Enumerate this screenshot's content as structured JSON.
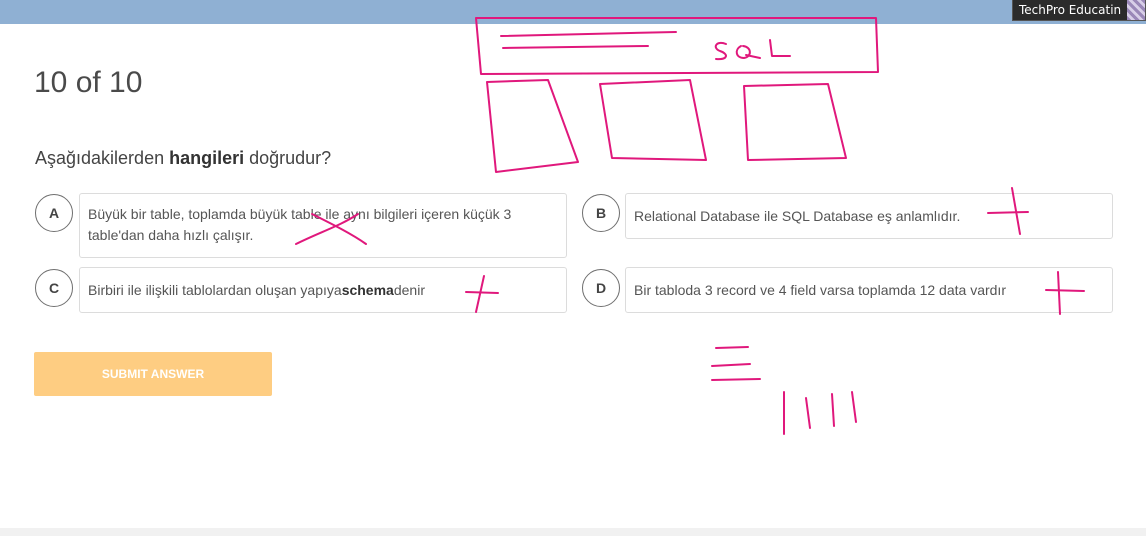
{
  "video": {
    "participant_name": "TechPro Educatin"
  },
  "quiz": {
    "progress": "10 of 10",
    "question_pre": "Aşağıdakilerden ",
    "question_bold": "hangileri",
    "question_post": " doğrudur?",
    "options": [
      {
        "letter": "A",
        "text": "Büyük bir table, toplamda büyük table ile aynı bilgileri içeren küçük 3 table'dan daha hızlı çalışır."
      },
      {
        "letter": "B",
        "text": "Relational Database ile SQL Database eş anlamlıdır."
      },
      {
        "letter": "C",
        "text_pre": "Birbiri ile ilişkili tablolardan oluşan yapıya ",
        "text_bold": "schema",
        "text_post": " denir"
      },
      {
        "letter": "D",
        "text": "Bir tabloda 3 record ve 4 field varsa toplamda 12 data vardır"
      }
    ],
    "submit_label": "SUBMIT ANSWER",
    "submit_color": "#fecd82"
  },
  "annotations": {
    "handwritten_label": "SQL",
    "ink_color": "#e0187c"
  }
}
